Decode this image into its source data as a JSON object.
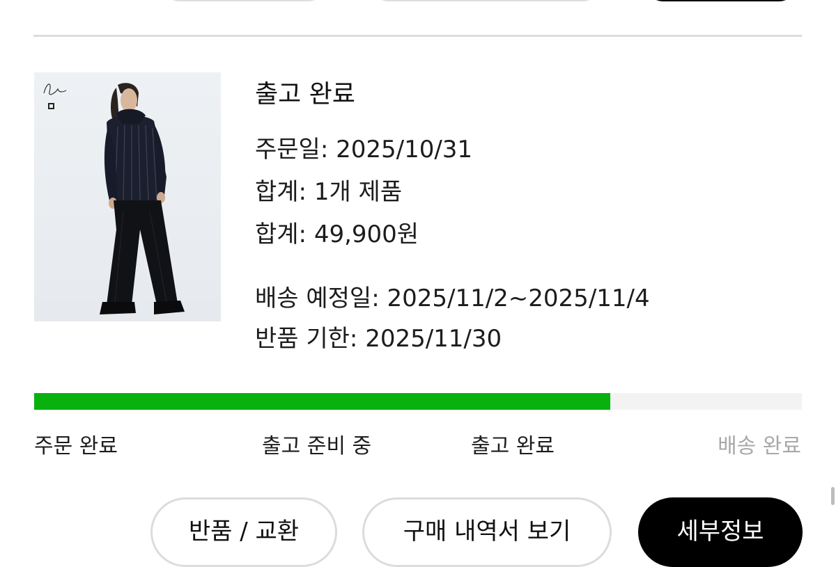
{
  "order": {
    "status_title": "출고 완료",
    "order_date": "주문일: 2025/10/31",
    "total_items": "합계: 1개 제품",
    "total_price": "합계: 49,900원",
    "ship_date": "배송 예정일: 2025/11/2~2025/11/4",
    "return_deadline": "반품 기한: 2025/11/30"
  },
  "progress": {
    "fraction": 0.75,
    "fill_color": "#08b10e",
    "steps": [
      {
        "label": "주문 완료",
        "active": true
      },
      {
        "label": "출고 준비 중",
        "active": true
      },
      {
        "label": "출고 완료",
        "active": true
      },
      {
        "label": "배송 완료",
        "active": false
      }
    ]
  },
  "actions": {
    "return_exchange": "반품 / 교환",
    "view_receipt": "구매 내역서 보기",
    "details": "세부정보"
  },
  "product_image": {
    "subject": "model-in-dark-track-outfit",
    "icon": "product-photo"
  }
}
